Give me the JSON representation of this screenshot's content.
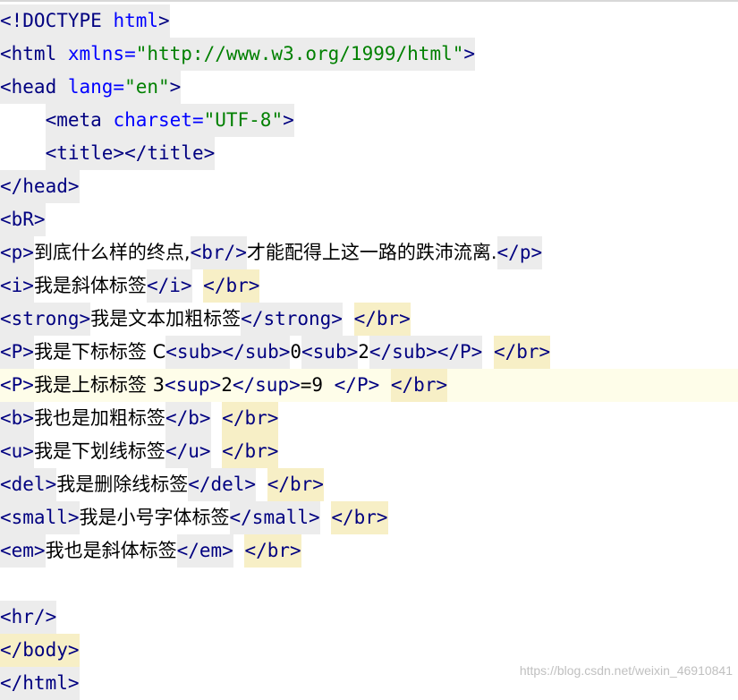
{
  "code_lines": [
    [
      {
        "t": "<!DOCTYPE ",
        "c": "t",
        "b": "g"
      },
      {
        "t": "html",
        "c": "a",
        "b": "g"
      },
      {
        "t": ">",
        "c": "t",
        "b": "g"
      }
    ],
    [
      {
        "t": "<html ",
        "c": "t",
        "b": "g"
      },
      {
        "t": "xmlns=",
        "c": "a",
        "b": "g"
      },
      {
        "t": "\"http://www.w3.org/1999/html\"",
        "c": "s",
        "b": "g"
      },
      {
        "t": ">",
        "c": "t",
        "b": "g"
      }
    ],
    [
      {
        "t": "<head ",
        "c": "t",
        "b": "g"
      },
      {
        "t": "lang=",
        "c": "a",
        "b": "g"
      },
      {
        "t": "\"en\"",
        "c": "s",
        "b": "g"
      },
      {
        "t": ">",
        "c": "t",
        "b": "g"
      }
    ],
    [
      {
        "t": "    ",
        "c": "p"
      },
      {
        "t": "<meta ",
        "c": "t",
        "b": "g"
      },
      {
        "t": "charset=",
        "c": "a",
        "b": "g"
      },
      {
        "t": "\"UTF-8\"",
        "c": "s",
        "b": "g"
      },
      {
        "t": ">",
        "c": "t",
        "b": "g"
      }
    ],
    [
      {
        "t": "    ",
        "c": "p"
      },
      {
        "t": "<title></title>",
        "c": "t",
        "b": "g"
      }
    ],
    [
      {
        "t": "</head>",
        "c": "t",
        "b": "g"
      }
    ],
    [
      {
        "t": "<bR>",
        "c": "t",
        "b": "g"
      }
    ],
    [
      {
        "t": "<p>",
        "c": "t",
        "b": "g"
      },
      {
        "t": "到底什么样的终点,",
        "c": "p"
      },
      {
        "t": "<br/>",
        "c": "t",
        "b": "g"
      },
      {
        "t": "才能配得上这一路的跌沛流离.",
        "c": "p"
      },
      {
        "t": "</p>",
        "c": "t",
        "b": "g"
      }
    ],
    [
      {
        "t": "<i>",
        "c": "t",
        "b": "g"
      },
      {
        "t": "我是斜体标签",
        "c": "p"
      },
      {
        "t": "</i>",
        "c": "t",
        "b": "g"
      },
      {
        "t": " ",
        "c": "p"
      },
      {
        "t": "</br>",
        "c": "t",
        "b": "m"
      }
    ],
    [
      {
        "t": "<strong>",
        "c": "t",
        "b": "g"
      },
      {
        "t": "我是文本加粗标签",
        "c": "p"
      },
      {
        "t": "</strong>",
        "c": "t",
        "b": "g"
      },
      {
        "t": " ",
        "c": "p"
      },
      {
        "t": "</br>",
        "c": "t",
        "b": "m"
      }
    ],
    [
      {
        "t": "<P>",
        "c": "t",
        "b": "g"
      },
      {
        "t": "我是下标标签 C",
        "c": "p"
      },
      {
        "t": "<sub></sub>",
        "c": "t",
        "b": "g"
      },
      {
        "t": "0",
        "c": "p"
      },
      {
        "t": "<sub>",
        "c": "t",
        "b": "g"
      },
      {
        "t": "2",
        "c": "p"
      },
      {
        "t": "</sub></P>",
        "c": "t",
        "b": "g"
      },
      {
        "t": " ",
        "c": "p"
      },
      {
        "t": "</br>",
        "c": "t",
        "b": "m"
      }
    ],
    [
      {
        "t": "<P>",
        "c": "t"
      },
      {
        "t": "我是上标标签 3",
        "c": "p"
      },
      {
        "t": "<sup>",
        "c": "t"
      },
      {
        "t": "2",
        "c": "p"
      },
      {
        "t": "</sup>",
        "c": "t"
      },
      {
        "t": "=9 ",
        "c": "p"
      },
      {
        "t": "</P>",
        "c": "t"
      },
      {
        "t": " ",
        "c": "p"
      },
      {
        "t": "</br>",
        "c": "t",
        "b": "m"
      }
    ],
    [
      {
        "t": "<b>",
        "c": "t",
        "b": "g"
      },
      {
        "t": "我也是加粗标签",
        "c": "p"
      },
      {
        "t": "</b>",
        "c": "t",
        "b": "g"
      },
      {
        "t": " ",
        "c": "p"
      },
      {
        "t": "</br>",
        "c": "t",
        "b": "m"
      }
    ],
    [
      {
        "t": "<u>",
        "c": "t",
        "b": "g"
      },
      {
        "t": "我是下划线标签",
        "c": "p"
      },
      {
        "t": "</u>",
        "c": "t",
        "b": "g"
      },
      {
        "t": " ",
        "c": "p"
      },
      {
        "t": "</br>",
        "c": "t",
        "b": "m"
      }
    ],
    [
      {
        "t": "<del>",
        "c": "t",
        "b": "g"
      },
      {
        "t": "我是删除线标签",
        "c": "p"
      },
      {
        "t": "</del>",
        "c": "t",
        "b": "g"
      },
      {
        "t": " ",
        "c": "p"
      },
      {
        "t": "</br>",
        "c": "t",
        "b": "m"
      }
    ],
    [
      {
        "t": "<small>",
        "c": "t",
        "b": "g"
      },
      {
        "t": "我是小号字体标签",
        "c": "p"
      },
      {
        "t": "</small>",
        "c": "t",
        "b": "g"
      },
      {
        "t": " ",
        "c": "p"
      },
      {
        "t": "</br>",
        "c": "t",
        "b": "m"
      }
    ],
    [
      {
        "t": "<em>",
        "c": "t",
        "b": "g"
      },
      {
        "t": "我也是斜体标签",
        "c": "p"
      },
      {
        "t": "</em>",
        "c": "t",
        "b": "g"
      },
      {
        "t": " ",
        "c": "p"
      },
      {
        "t": "</br>",
        "c": "t",
        "b": "m"
      }
    ],
    [],
    [
      {
        "t": "<hr/>",
        "c": "t",
        "b": "g"
      }
    ],
    [
      {
        "t": "</body>",
        "c": "t",
        "b": "m"
      }
    ],
    [
      {
        "t": "</html>",
        "c": "t",
        "b": "g"
      }
    ]
  ],
  "current_line_index": 11,
  "watermark": "https://blog.csdn.net/weixin_46910841",
  "colors": {
    "tag": "#000080",
    "attribute": "#0000ff",
    "string": "#008000",
    "text": "#000000",
    "tag_background": "#ececec",
    "matched_tag_background": "#f7efc6",
    "current_line_background": "#fefde9"
  }
}
